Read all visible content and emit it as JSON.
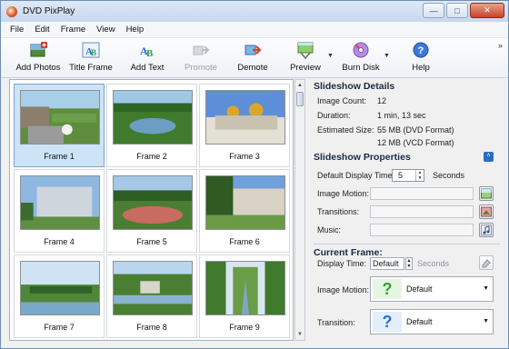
{
  "window": {
    "title": "DVD PixPlay"
  },
  "menu": [
    "File",
    "Edit",
    "Frame",
    "View",
    "Help"
  ],
  "toolbar": {
    "add_photos": "Add Photos",
    "title_frame": "Title Frame",
    "add_text": "Add Text",
    "promote": "Promote",
    "demote": "Demote",
    "preview": "Preview",
    "burn_disk": "Burn Disk",
    "help": "Help",
    "overflow": "»"
  },
  "frames": [
    {
      "label": "Frame 1",
      "selected": true
    },
    {
      "label": "Frame 2",
      "selected": false
    },
    {
      "label": "Frame 3",
      "selected": false
    },
    {
      "label": "Frame 4",
      "selected": false
    },
    {
      "label": "Frame 5",
      "selected": false
    },
    {
      "label": "Frame 6",
      "selected": false
    },
    {
      "label": "Frame 7",
      "selected": false
    },
    {
      "label": "Frame 8",
      "selected": false
    },
    {
      "label": "Frame 9",
      "selected": false
    }
  ],
  "details": {
    "title": "Slideshow Details",
    "image_count_label": "Image Count:",
    "image_count": "12",
    "duration_label": "Duration:",
    "duration": "1 min, 13 sec",
    "estimated_size_label": "Estimated Size:",
    "size_dvd": "55 MB (DVD Format)",
    "size_vcd": "12 MB (VCD Format)"
  },
  "properties": {
    "title": "Slideshow Properties",
    "display_time_label": "Default Display Time:",
    "display_time": "5",
    "display_time_unit": "Seconds",
    "image_motion_label": "Image Motion:",
    "transitions_label": "Transitions:",
    "music_label": "Music:"
  },
  "current_frame": {
    "title": "Current Frame:",
    "display_time_label": "Display Time:",
    "display_time": "Default",
    "display_time_unit": "Seconds",
    "image_motion_label": "Image Motion:",
    "image_motion": "Default",
    "transition_label": "Transition:",
    "transition": "Default"
  },
  "colors": {
    "accent": "#2b6cc4",
    "selection": "#cde4f7",
    "green_q": "#2aa52a",
    "blue_q": "#2c6fd0"
  }
}
